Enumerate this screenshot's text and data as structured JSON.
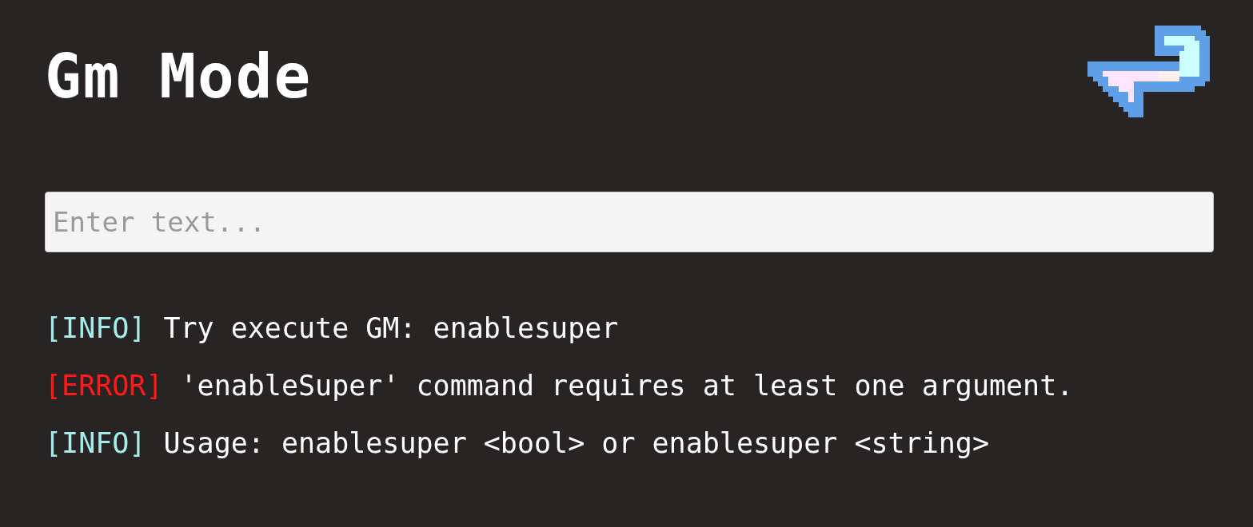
{
  "title": "Gm Mode",
  "input": {
    "placeholder": "Enter text..."
  },
  "log": [
    {
      "kind": "info",
      "tag": "[INFO]",
      "message": "Try execute GM: enablesuper"
    },
    {
      "kind": "error",
      "tag": "[ERROR]",
      "message": "'enableSuper' command requires at least one argument."
    },
    {
      "kind": "info",
      "tag": "[INFO]",
      "message": "Usage: enablesuper <bool> or enablesuper <string>"
    }
  ]
}
